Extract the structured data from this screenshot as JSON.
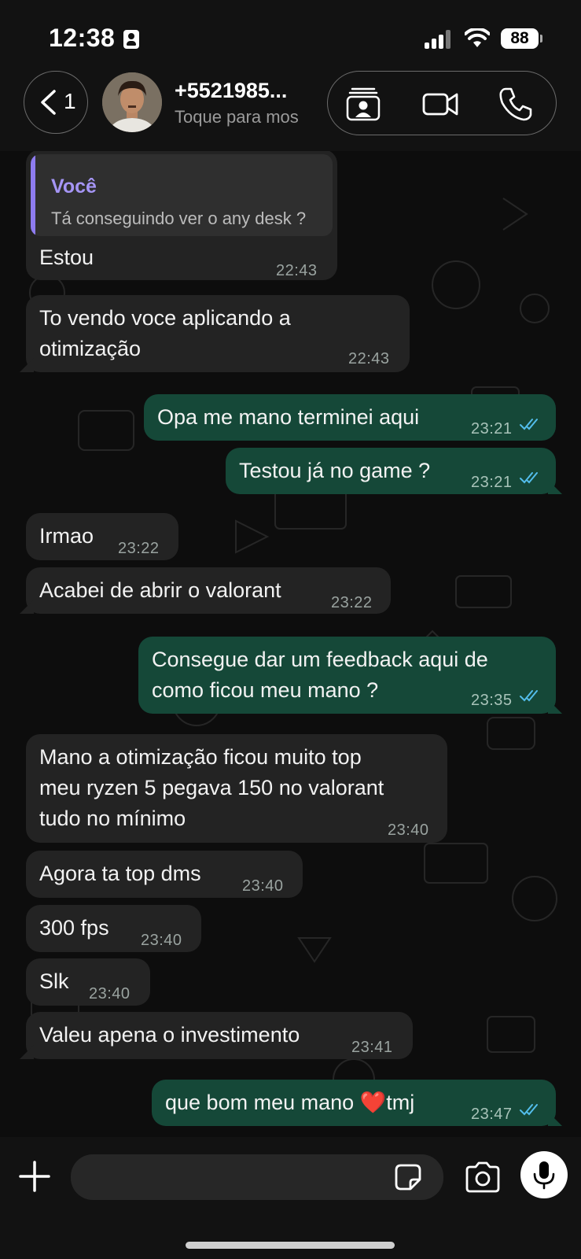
{
  "status": {
    "time": "12:38",
    "battery": "88"
  },
  "header": {
    "back_count": "1",
    "contact_name": "+5521985...",
    "contact_sub": "Toque para mos"
  },
  "colors": {
    "incoming": "#232323",
    "outgoing": "#154838",
    "read_ticks": "#53bdeb",
    "quote_accent": "#8e7cf0"
  },
  "icons": [
    "chevron-left-icon",
    "contact-card-icon",
    "video-camera-icon",
    "phone-icon",
    "plus-icon",
    "sticker-icon",
    "camera-icon",
    "microphone-icon"
  ],
  "messages": [
    {
      "dir": "in",
      "reply_author": "Você",
      "reply_text": "Tá conseguindo ver o any desk ?",
      "lines": [
        "Estou"
      ],
      "time": "22:43"
    },
    {
      "dir": "in",
      "lines": [
        "To vendo voce aplicando a",
        "otimização"
      ],
      "time": "22:43"
    },
    {
      "dir": "out",
      "lines": [
        "Opa me mano terminei aqui"
      ],
      "time": "23:21"
    },
    {
      "dir": "out",
      "lines": [
        "Testou já no game ?"
      ],
      "time": "23:21"
    },
    {
      "dir": "in",
      "lines": [
        "Irmao"
      ],
      "time": "23:22"
    },
    {
      "dir": "in",
      "lines": [
        "Acabei de abrir o valorant"
      ],
      "time": "23:22"
    },
    {
      "dir": "out",
      "lines": [
        "Consegue dar um feedback aqui de",
        "como ficou meu mano ?"
      ],
      "time": "23:35"
    },
    {
      "dir": "in",
      "lines": [
        "Mano a otimização ficou muito top",
        "meu ryzen 5 pegava 150 no valorant",
        "tudo no mínimo"
      ],
      "time": "23:40"
    },
    {
      "dir": "in",
      "lines": [
        "Agora ta top dms"
      ],
      "time": "23:40"
    },
    {
      "dir": "in",
      "lines": [
        "300 fps"
      ],
      "time": "23:40"
    },
    {
      "dir": "in",
      "lines": [
        "Slk"
      ],
      "time": "23:40"
    },
    {
      "dir": "in",
      "lines": [
        "Valeu apena o investimento"
      ],
      "time": "23:41"
    },
    {
      "dir": "out",
      "lines": [
        "que bom meu mano ❤️tmj"
      ],
      "time": "23:47"
    }
  ],
  "composer": {
    "placeholder": ""
  }
}
